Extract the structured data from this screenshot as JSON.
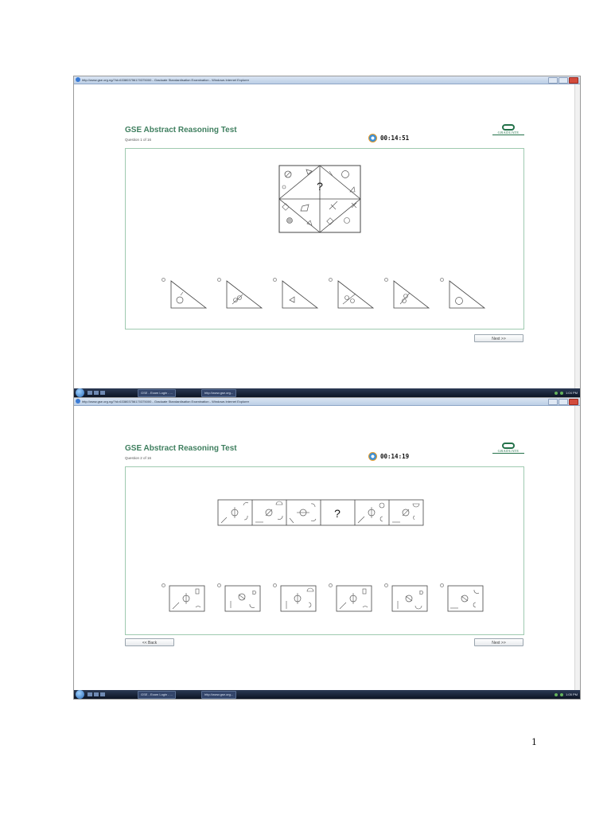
{
  "screens": [
    {
      "browser_title": "http://www.gse.org.ng/?id=633803756170375000 - Graduate Standardisation Examination - Windows Internet Explorer",
      "app_title": "GSE Abstract Reasoning Test",
      "question_label": "Question 1 of 16",
      "timer": "00:14:51",
      "logo_text": "GRADUATE",
      "next_label": "Next >>",
      "taskbar": {
        "btn1": "GSE - Exam Login - ...",
        "btn2": "http://www.gse.org...",
        "clock": "1:04 PM"
      }
    },
    {
      "browser_title": "http://www.gse.org.ng/?id=633803756170375000 - Graduate Standardisation Examination - Windows Internet Explorer",
      "app_title": "GSE Abstract Reasoning Test",
      "question_label": "Question 2 of 16",
      "timer": "00:14:19",
      "logo_text": "GRADUATE",
      "back_label": "<< Back",
      "next_label": "Next >>",
      "taskbar": {
        "btn1": "GSE - Exam Login - ...",
        "btn2": "http://www.gse.org...",
        "clock": "1:05 PM"
      }
    }
  ],
  "question_mark": "?",
  "page_number": "1"
}
